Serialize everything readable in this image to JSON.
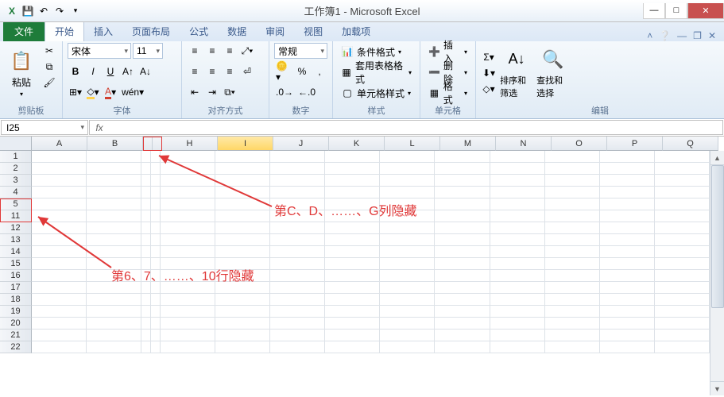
{
  "title": "工作簿1 - Microsoft Excel",
  "qat": {
    "excel": "X",
    "save": "💾",
    "undo": "↶",
    "redo": "↷"
  },
  "tabs": {
    "file": "文件",
    "items": [
      "开始",
      "插入",
      "页面布局",
      "公式",
      "数据",
      "审阅",
      "视图",
      "加载项"
    ],
    "active_index": 0
  },
  "ribbon": {
    "clipboard": {
      "label": "剪贴板",
      "paste": "粘贴"
    },
    "font": {
      "label": "字体",
      "name": "宋体",
      "size": "11",
      "bold": "B",
      "italic": "I",
      "underline": "U"
    },
    "alignment": {
      "label": "对齐方式"
    },
    "number": {
      "label": "数字",
      "format": "常规"
    },
    "styles": {
      "label": "样式",
      "conditional": "条件格式",
      "table_format": "套用表格格式",
      "cell_style": "单元格样式"
    },
    "cells": {
      "label": "单元格",
      "insert": "插入",
      "delete": "删除",
      "format": "格式"
    },
    "editing": {
      "label": "编辑",
      "sort": "排序和筛选",
      "find": "查找和选择"
    }
  },
  "namebox": "I25",
  "formula": "",
  "fx_symbol": "fx",
  "columns": [
    "A",
    "B",
    "",
    "",
    "H",
    "I",
    "J",
    "K",
    "L",
    "M",
    "N",
    "O",
    "P",
    "Q"
  ],
  "selected_col_index": 5,
  "rows": [
    1,
    2,
    3,
    4,
    5,
    11,
    12,
    13,
    14,
    15,
    16,
    17,
    18,
    19,
    20,
    21,
    22
  ],
  "anno": {
    "cols_hidden": "第C、D、……、G列隐藏",
    "rows_hidden": "第6、7、……、10行隐藏"
  }
}
